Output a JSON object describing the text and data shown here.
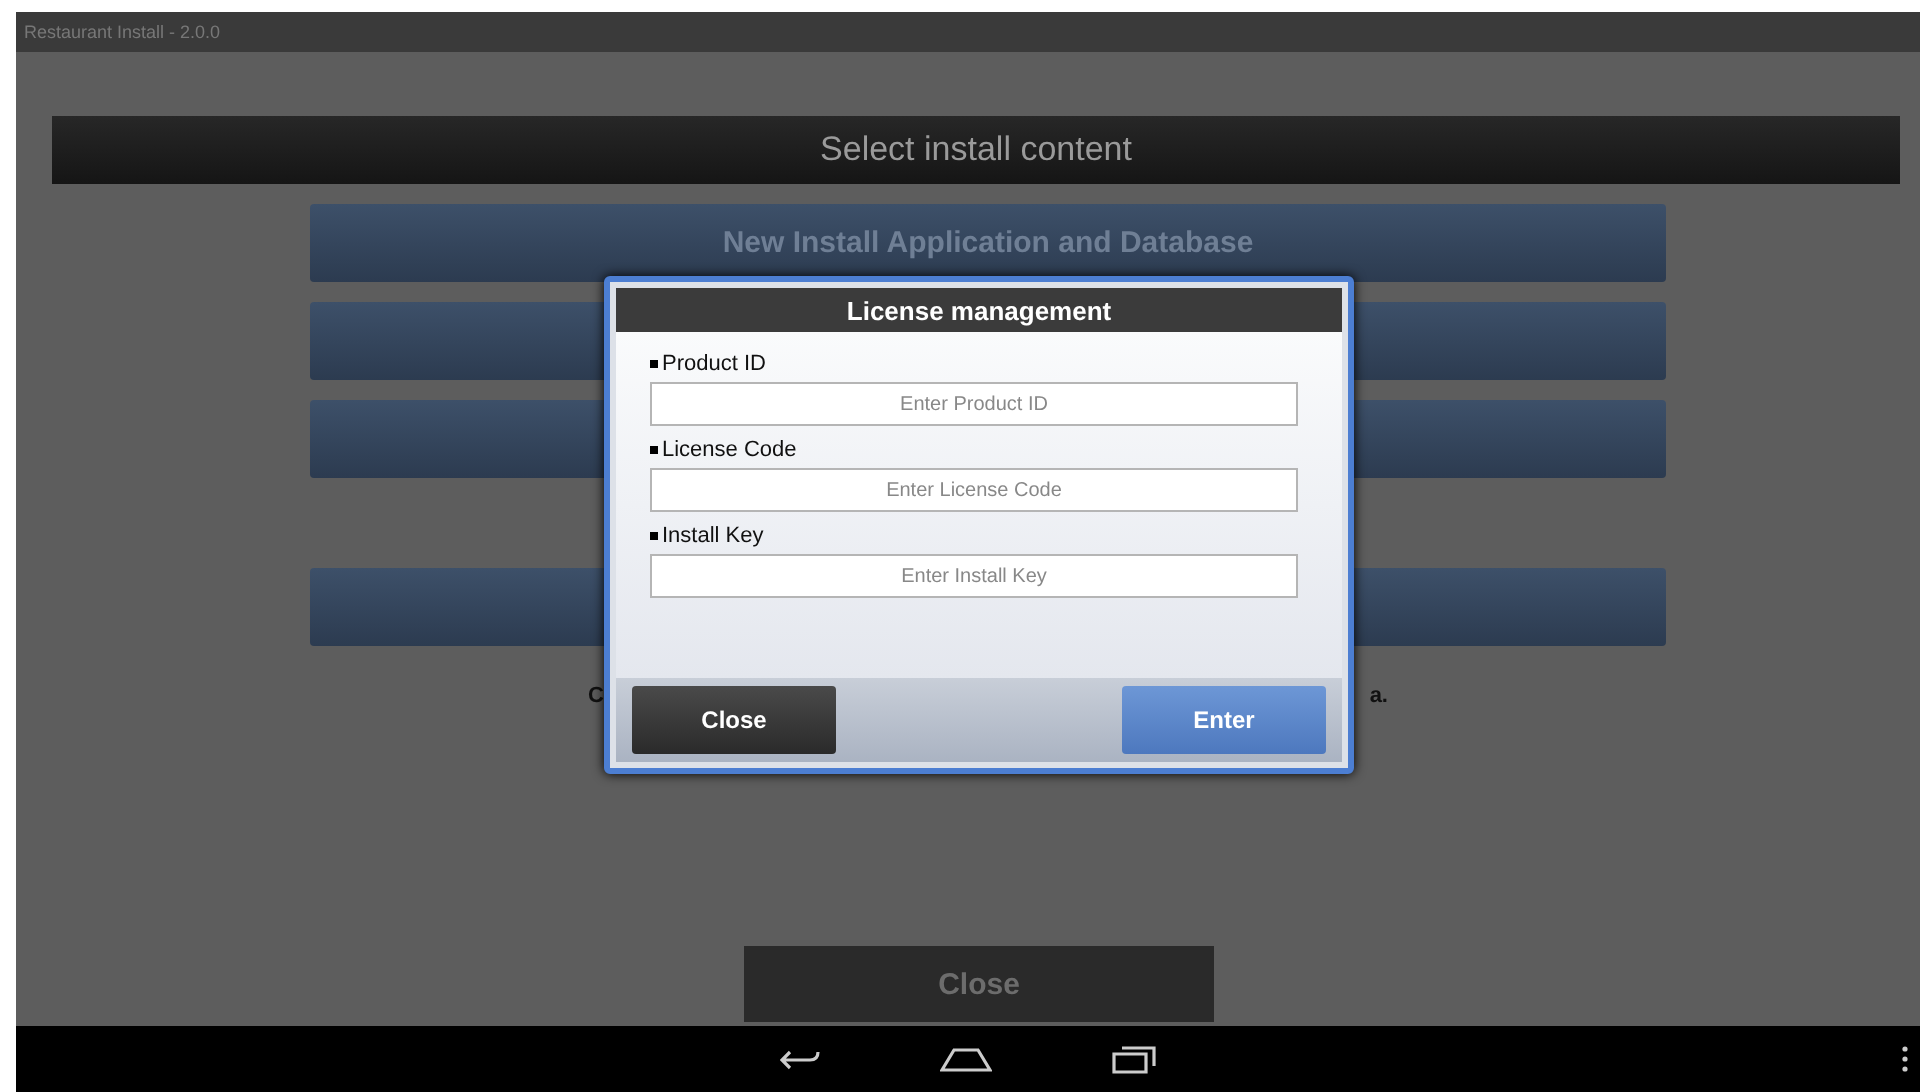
{
  "window": {
    "title": "Restaurant Install - 2.0.0"
  },
  "header": {
    "title": "Select install content"
  },
  "button_groups": [
    [
      {
        "kind": "labeled",
        "label": "New Install Application and Database"
      },
      {
        "kind": "covered"
      },
      {
        "kind": "covered"
      }
    ],
    [
      {
        "kind": "covered"
      }
    ]
  ],
  "note": {
    "left": "C",
    "right": "a."
  },
  "close_button": {
    "label": "Close"
  },
  "dialog": {
    "title": "License management",
    "fields": [
      {
        "label": "Product ID",
        "placeholder": "Enter Product ID"
      },
      {
        "label": "License Code",
        "placeholder": "Enter License Code"
      },
      {
        "label": "Install Key",
        "placeholder": "Enter Install Key"
      }
    ],
    "buttons": [
      {
        "label": "Close",
        "kind": "secondary"
      },
      {
        "label": "Enter",
        "kind": "primary"
      }
    ]
  }
}
